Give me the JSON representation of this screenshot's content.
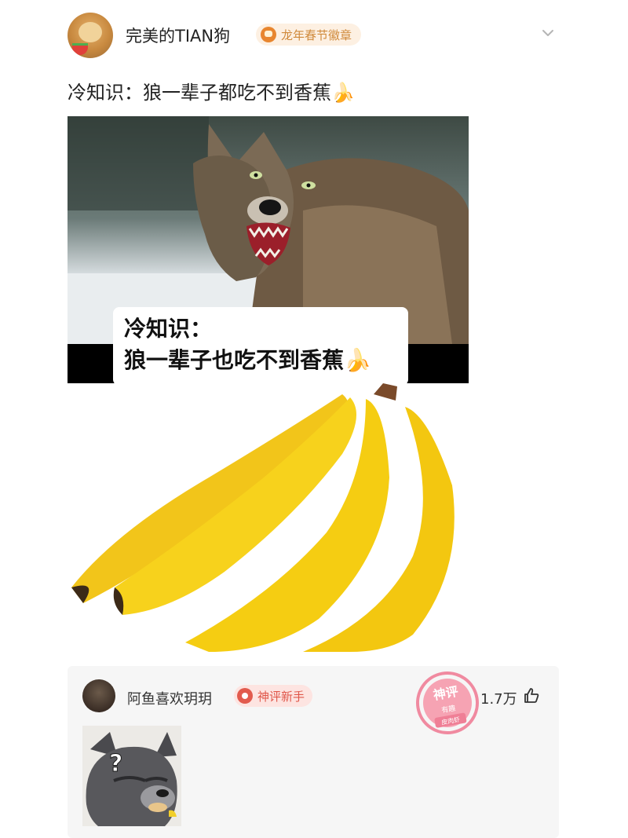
{
  "post": {
    "author": "完美的TIAN狗",
    "badge": "龙年春节徽章",
    "text": "冷知识：狼一辈子都吃不到香蕉🍌"
  },
  "meme": {
    "caption_line1": "冷知识：",
    "caption_line2": "狼一辈子也吃不到香蕉🍌"
  },
  "comment": {
    "author": "阿鱼喜欢玥玥",
    "badge": "神评新手",
    "stamp_title": "神评",
    "stamp_subtitle": "有趣",
    "stamp_footer": "皮肉虾",
    "likes": "1.7万"
  },
  "icons": {
    "chevron": "chevron-down-icon",
    "like": "thumbs-up-icon",
    "badge_post": "tiger-icon",
    "badge_comment": "god-comment-icon"
  },
  "colors": {
    "badge_post_text": "#d08a3b",
    "badge_post_bg": "#fdf0e2",
    "badge_comment_text": "#e0574a",
    "badge_comment_bg": "#fde4e1",
    "stamp": "#f08aa0"
  }
}
